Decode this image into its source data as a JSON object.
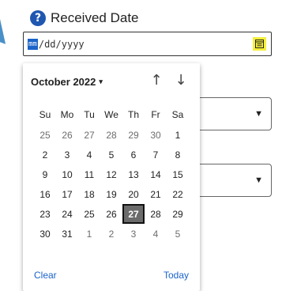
{
  "field": {
    "label": "Received Date",
    "help_icon": "?",
    "segment_month": "mm",
    "segment_rest": "/dd/yyyy"
  },
  "picker": {
    "month_label": "October 2022",
    "caret": "▾",
    "nav_up": "↑",
    "nav_down": "↓",
    "weekdays": [
      "Su",
      "Mo",
      "Tu",
      "We",
      "Th",
      "Fr",
      "Sa"
    ],
    "weeks": [
      [
        "25",
        "26",
        "27",
        "28",
        "29",
        "30",
        "1"
      ],
      [
        "2",
        "3",
        "4",
        "5",
        "6",
        "7",
        "8"
      ],
      [
        "9",
        "10",
        "11",
        "12",
        "13",
        "14",
        "15"
      ],
      [
        "16",
        "17",
        "18",
        "19",
        "20",
        "21",
        "22"
      ],
      [
        "23",
        "24",
        "25",
        "26",
        "27",
        "28",
        "29"
      ],
      [
        "30",
        "31",
        "1",
        "2",
        "3",
        "4",
        "5"
      ]
    ],
    "selected_day": "27",
    "clear_label": "Clear",
    "today_label": "Today"
  },
  "colors": {
    "accent": "#1a63c9",
    "help_icon_bg": "#1f57b0",
    "calendar_button_highlight": "#f5ef3a",
    "selected_day_bg": "#6b6b6b"
  }
}
